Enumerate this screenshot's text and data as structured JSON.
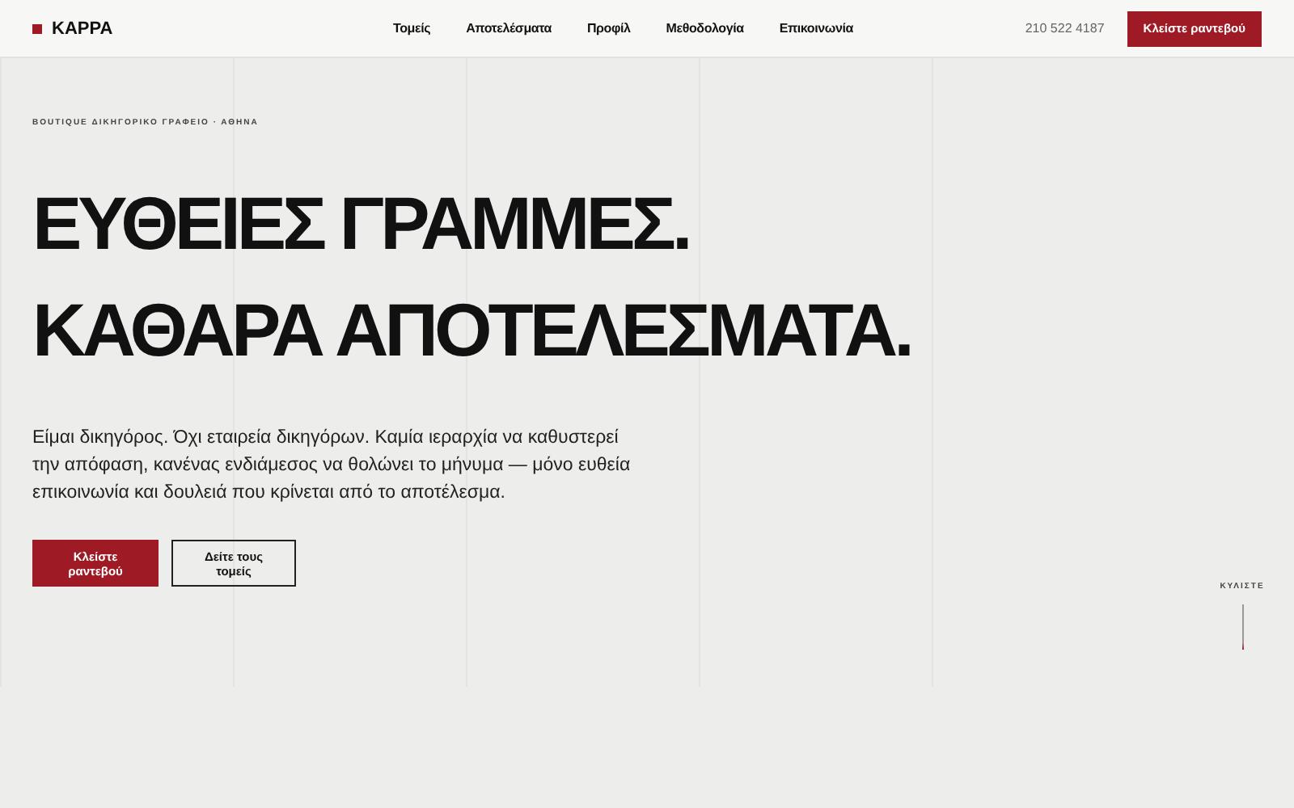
{
  "header": {
    "logo": "KAPPA",
    "nav": [
      {
        "label": "Τομείς"
      },
      {
        "label": "Αποτελέσματα"
      },
      {
        "label": "Προφίλ"
      },
      {
        "label": "Μεθοδολογία"
      },
      {
        "label": "Επικοινωνία"
      }
    ],
    "phone": "210 522 4187",
    "cta": "Κλείστε ραντεβού"
  },
  "hero": {
    "eyebrow": "BOUTIQUE ΔΙΚΗΓΟΡΙΚΟ ΓΡΑΦΕΙΟ · ΑΘΗΝΑ",
    "headline": [
      "ΕΥΘΕΙΕΣ ΓΡΑΜΜΕΣ.",
      "ΚΑΘΑΡΑ ΑΠΟΤΕΛΕΣΜΑΤΑ."
    ],
    "lead": "Είμαι δικηγόρος. Όχι εταιρεία δικηγόρων. Καμία ιεραρχία να καθυστερεί την απόφαση, κανένας ενδιάμεσος να θολώνει το μήνυμα — μόνο ευθεία επικοινωνία και δουλειά που κρίνεται από το αποτέλεσμα.",
    "buttons": [
      {
        "label": "Κλείστε ραντεβού",
        "kind": "primary"
      },
      {
        "label": "Δείτε τους τομείς",
        "kind": "outline"
      }
    ],
    "scroll": "ΚΥΛΙΣΤΕ"
  }
}
